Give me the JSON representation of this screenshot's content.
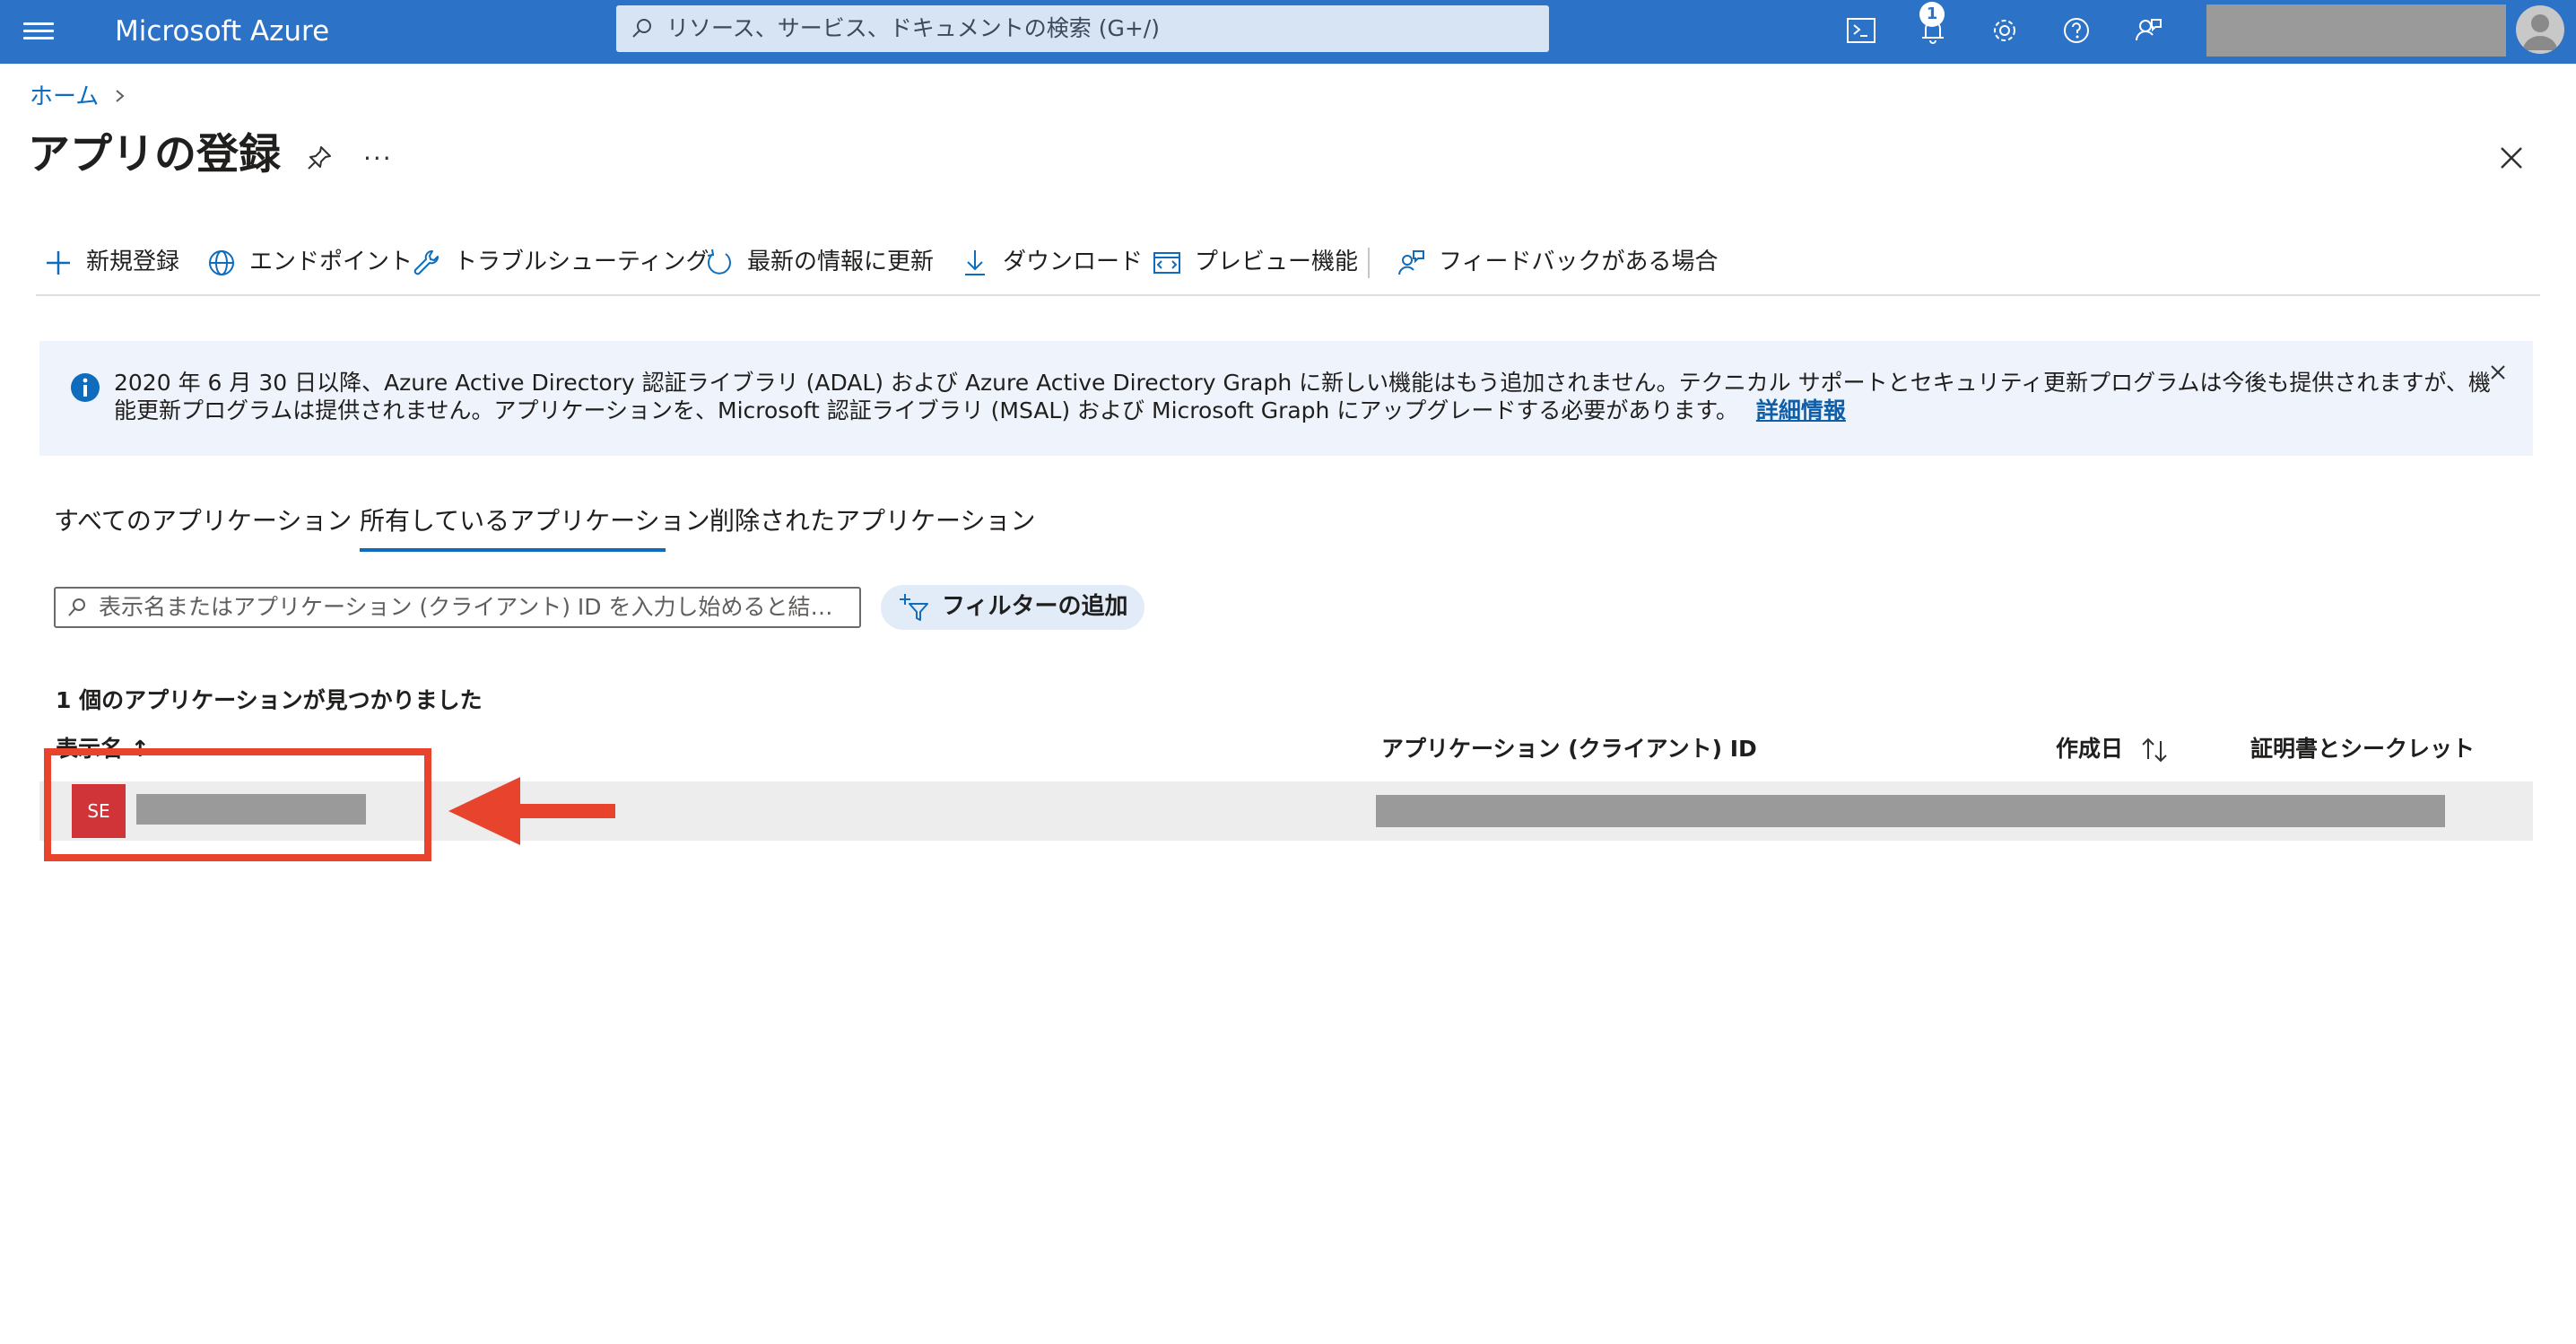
{
  "topbar": {
    "brand": "Microsoft Azure",
    "search_placeholder": "リソース、サービス、ドキュメントの検索 (G+/)",
    "notification_count": "1",
    "icons": [
      "hamburger-menu-icon",
      "search-icon",
      "cloud-shell-icon",
      "notification-bell-icon",
      "settings-gear-icon",
      "help-question-icon",
      "feedback-icon",
      "avatar"
    ],
    "color": "#2c72c7"
  },
  "breadcrumb": {
    "home": "ホーム"
  },
  "page": {
    "title": "アプリの登録",
    "more": "···"
  },
  "commands": [
    {
      "label": "新規登録",
      "icon": "plus-icon"
    },
    {
      "label": "エンドポイント",
      "icon": "globe-icon"
    },
    {
      "label": "トラブルシューティング",
      "icon": "wrench-icon"
    },
    {
      "label": "最新の情報に更新",
      "icon": "refresh-icon"
    },
    {
      "label": "ダウンロード",
      "icon": "download-icon"
    },
    {
      "label": "プレビュー機能",
      "icon": "preview-icon"
    },
    {
      "label": "フィードバックがある場合",
      "icon": "feedback-icon"
    }
  ],
  "banner": {
    "message": "2020 年 6 月 30 日以降、Azure Active Directory 認証ライブラリ (ADAL) および Azure Active Directory Graph に新しい機能はもう追加されません。テクニカル サポートとセキュリティ更新プログラムは今後も提供されますが、機能更新プログラムは提供されません。アプリケーションを、Microsoft 認証ライブラリ (MSAL) および Microsoft Graph にアップグレードする必要があります。",
    "link": "詳細情報"
  },
  "tabs": [
    {
      "label": "すべてのアプリケーション",
      "selected": false
    },
    {
      "label": "所有しているアプリケーション",
      "selected": true
    },
    {
      "label": "削除されたアプリケーション",
      "selected": false
    }
  ],
  "filter": {
    "placeholder": "表示名またはアプリケーション (クライアント) ID を入力し始めると結果…",
    "add_filter_label": "フィルターの追加"
  },
  "results": {
    "count_text": "1 個のアプリケーションが見つかりました",
    "columns": {
      "display_name": "表示名 ↑",
      "client_id": "アプリケーション (クライアント) ID",
      "created": "作成日",
      "secrets": "証明書とシークレット"
    },
    "rows": [
      {
        "badge": "SE",
        "badge_color": "#d13438"
      }
    ]
  },
  "annotation": {
    "highlight_color": "#e8432d"
  }
}
